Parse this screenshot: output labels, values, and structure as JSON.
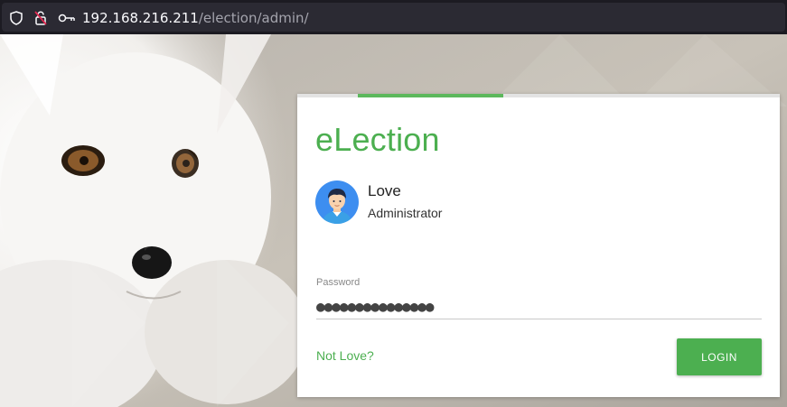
{
  "browser": {
    "url_host": "192.168.216.211",
    "url_path": "/election/admin/",
    "icons": [
      "shield-icon",
      "insecure-lock-icon",
      "key-icon"
    ]
  },
  "background": {
    "subject": "arctic-fox-photo",
    "accent_colors": [
      "#f4f4f2",
      "#6a4a2a",
      "#1a1a1a"
    ]
  },
  "login_card": {
    "brand": "eLection",
    "brand_color": "#4caf50",
    "progress_color": "#5cb85c",
    "user": {
      "name": "Love",
      "role": "Administrator",
      "avatar_icon": "user-avatar-icon"
    },
    "password": {
      "label": "Password",
      "value": "●●●●●●●●●●●●●●●"
    },
    "not_user_link": "Not Love?",
    "login_button": "LOGIN"
  }
}
